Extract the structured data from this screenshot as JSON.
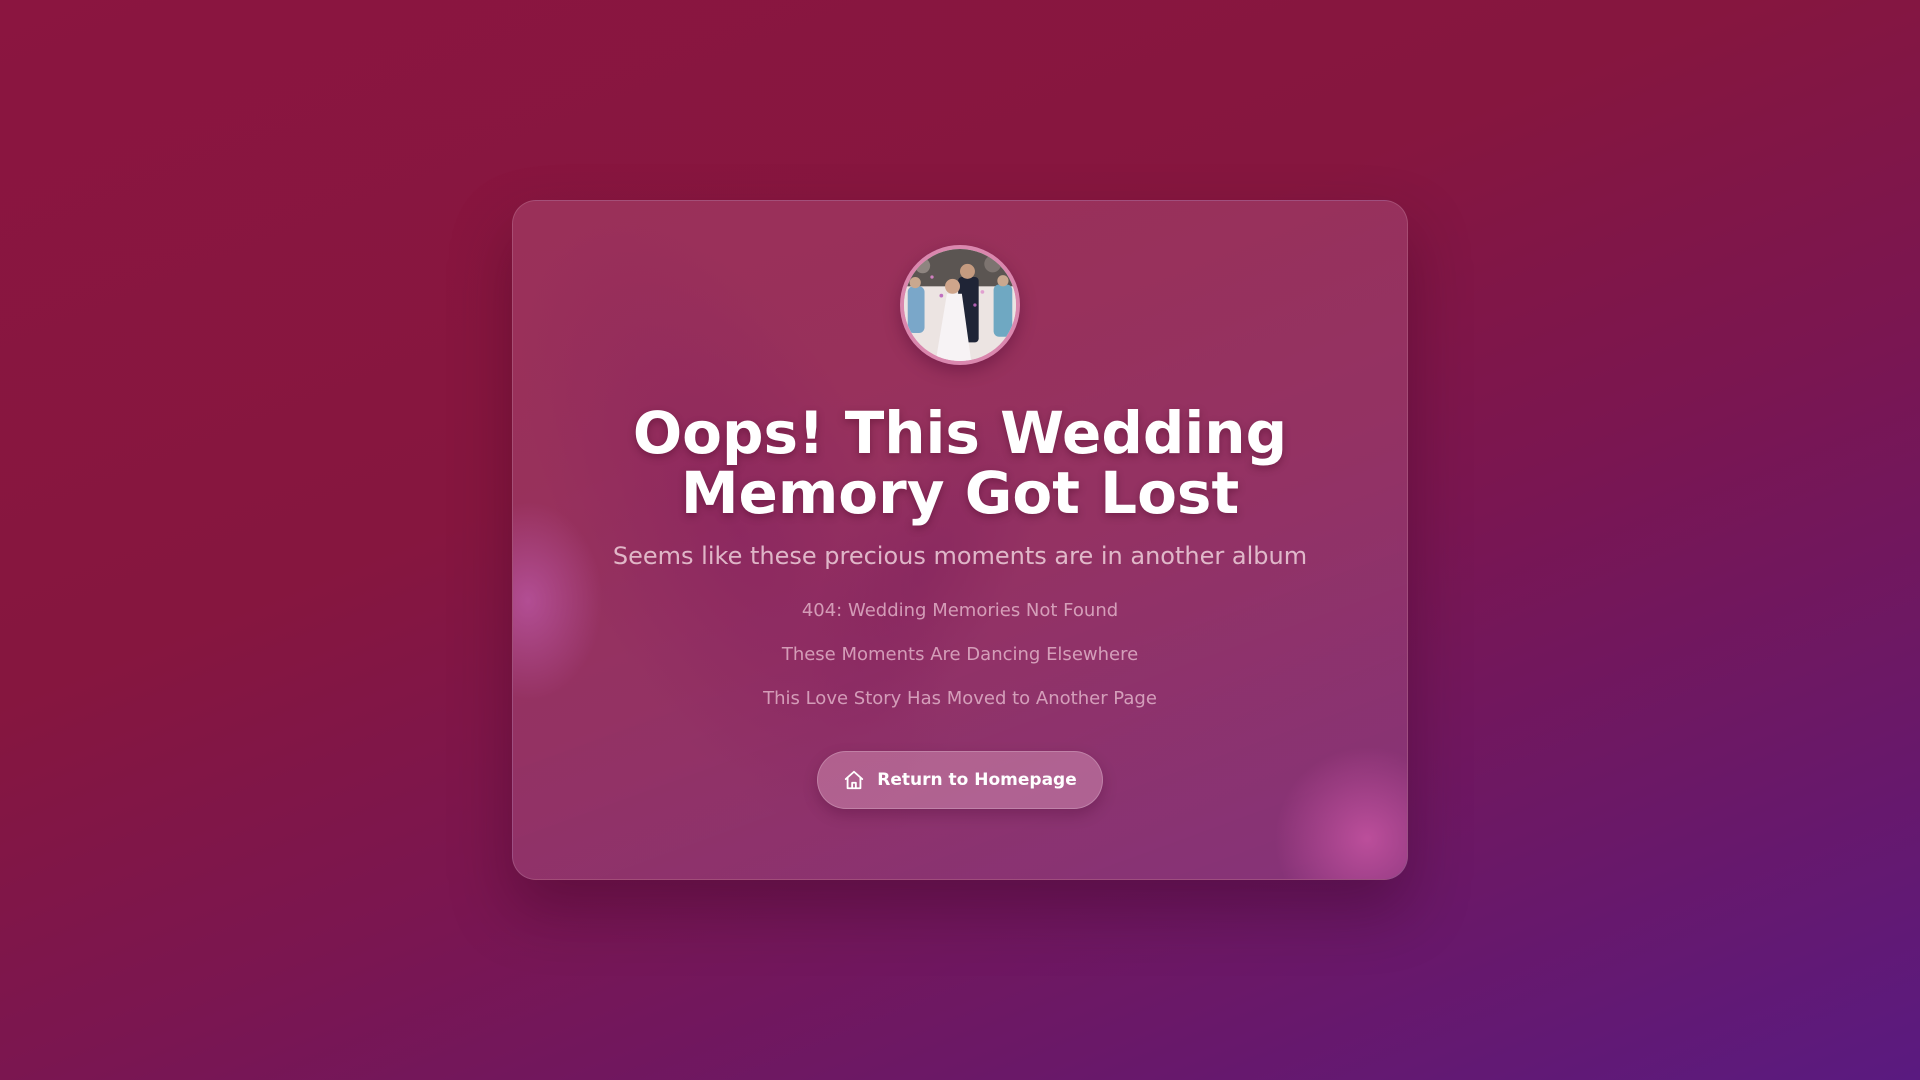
{
  "page": {
    "title": "Oops! This Wedding Memory Got Lost",
    "subtitle": "Seems like these precious moments are in another album",
    "messages": [
      "404: Wedding Memories Not Found",
      "These Moments Are Dancing Elsewhere",
      "This Love Story Has Moved to Another Page"
    ]
  },
  "button": {
    "label": "Return to Homepage",
    "icon": "home-icon"
  },
  "avatar": {
    "icon": "wedding-photo"
  },
  "colors": {
    "background_start": "#8b1540",
    "background_end": "#5a1a80",
    "title": "#ffffff",
    "avatar_border": "#d778a5"
  }
}
